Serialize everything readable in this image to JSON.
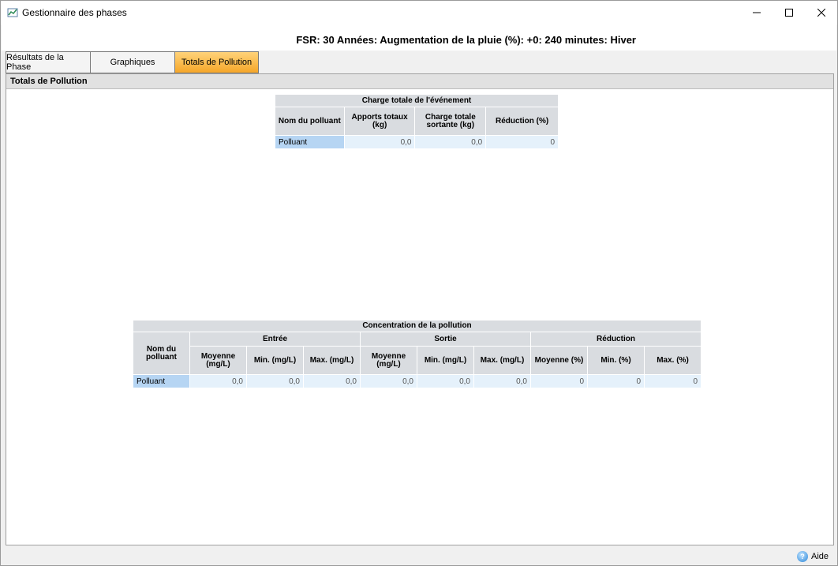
{
  "window": {
    "title": "Gestionnaire des phases"
  },
  "phase_title": "FSR: 30 Années: Augmentation de la pluie (%): +0: 240 minutes: Hiver",
  "tabs": [
    {
      "label": "Résultats de la Phase"
    },
    {
      "label": "Graphiques"
    },
    {
      "label": "Totals de Pollution",
      "active": true
    }
  ],
  "section": {
    "title": "Totals de Pollution"
  },
  "charge_table": {
    "title": "Charge totale de l'événement",
    "headers": [
      "Nom du polluant",
      "Apports totaux (kg)",
      "Charge totale sortante (kg)",
      "Réduction (%)"
    ],
    "rows": [
      {
        "name": "Polluant",
        "apports": "0,0",
        "sortante": "0,0",
        "reduction": "0"
      }
    ]
  },
  "concentration_table": {
    "title": "Concentration de la pollution",
    "name_header": "Nom du polluant",
    "groups": [
      "Entrée",
      "Sortie",
      "Réduction"
    ],
    "sub_headers": [
      "Moyenne (mg/L)",
      "Min. (mg/L)",
      "Max. (mg/L)",
      "Moyenne (mg/L)",
      "Min. (mg/L)",
      "Max. (mg/L)",
      "Moyenne (%)",
      "Min. (%)",
      "Max. (%)"
    ],
    "rows": [
      {
        "name": "Polluant",
        "values": [
          "0,0",
          "0,0",
          "0,0",
          "0,0",
          "0,0",
          "0,0",
          "0",
          "0",
          "0"
        ]
      }
    ]
  },
  "footer": {
    "help_label": "Aide"
  },
  "colors": {
    "active_tab": "#f5a628",
    "header_cell": "#d9dce0",
    "data_cell": "#e5f1fb",
    "name_cell": "#b6d5f3"
  }
}
